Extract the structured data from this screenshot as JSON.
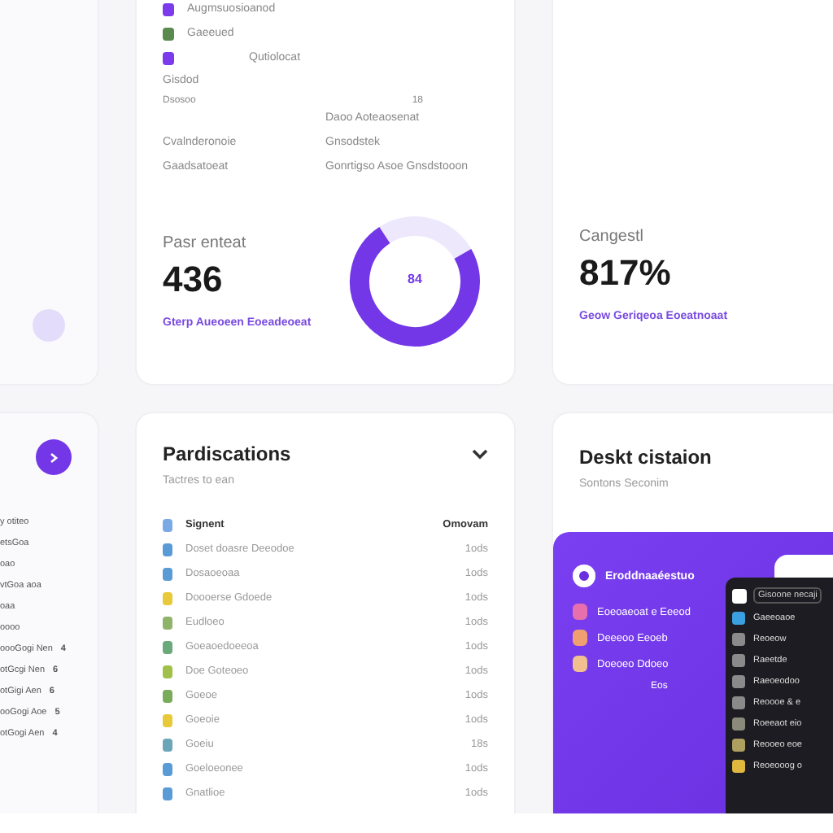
{
  "sidebar": {
    "items": [
      {
        "label": "y otiteo"
      },
      {
        "label": "etsGoa"
      },
      {
        "label": "oao"
      },
      {
        "label": "vtGoa aoa"
      },
      {
        "label": "oaa"
      },
      {
        "label": "oooo"
      },
      {
        "label": "oooGogi Nen",
        "count": "4"
      },
      {
        "label": "otGcgi Nen",
        "count": "6"
      },
      {
        "label": "otGigi Aen",
        "count": "6"
      },
      {
        "label": "ooGogi Aoe",
        "count": "5"
      },
      {
        "label": "otGogi Aen",
        "count": "4"
      }
    ]
  },
  "overview": {
    "items": [
      {
        "label": "Augmsuosioanod",
        "color": "#7c3aed"
      },
      {
        "label": "Gaeeued",
        "color": "#5b8a4e"
      },
      {
        "label": "Qutiolocat",
        "color": "#7c3aed"
      }
    ],
    "lines": [
      "Gisdod",
      "Dsosoo"
    ],
    "side_value": "18",
    "grid": [
      {
        "value": "Daoo Aoteaosenat"
      },
      {
        "label": "Cvalnderonoie",
        "value": "Gnsodstek"
      },
      {
        "label": "Gaadsatoeat",
        "value": "Gonrtigso Asoe Gnsdstooon"
      }
    ],
    "stat": {
      "label": "Pasr enteat",
      "value": "436",
      "link": "Gterp Aueoeen Eoeadeoeat"
    },
    "donut": {
      "center": "84",
      "level": 0.74
    }
  },
  "rate": {
    "label": "Cangestl",
    "value": "817%",
    "link": "Geow Geriqeoa Eoeatnoaat"
  },
  "publications": {
    "title": "Pardiscations",
    "subtitle": "Tactres to ean",
    "header": {
      "label": "Signent",
      "value": "Omovam"
    },
    "rows": [
      {
        "label": "Doset doasre Deeodoe",
        "value": "1ods",
        "color": "#5b9bd5"
      },
      {
        "label": "Dosaoeoaa",
        "value": "1ods",
        "color": "#5b9bd5"
      },
      {
        "label": "Doooerse Gdoede",
        "value": "1ods",
        "color": "#e8c93a"
      },
      {
        "label": "Eudloeo",
        "value": "1ods",
        "color": "#8fb36a"
      },
      {
        "label": "Goeaoedoeeoa",
        "value": "1ods",
        "color": "#6ba87a"
      },
      {
        "label": "Doe Goteoeo",
        "value": "1ods",
        "color": "#a0c04a"
      },
      {
        "label": "Goeoe",
        "value": "1ods",
        "color": "#7aab5a"
      },
      {
        "label": "Goeoie",
        "value": "1ods",
        "color": "#e8c93a"
      },
      {
        "label": "Goeiu",
        "value": "18s",
        "color": "#6aa6b8"
      },
      {
        "label": "Goeloeonee",
        "value": "1ods",
        "color": "#5b9bd5"
      },
      {
        "label": "Gnatlioe",
        "value": "1ods",
        "color": "#5b9bd5"
      }
    ]
  },
  "destination": {
    "title": "Deskt cistaion",
    "subtitle": "Sontons Seconim",
    "panel": {
      "heading": "Eroddnaaéestuo",
      "items": [
        {
          "label": "Eoeoaeoat e Eeeod",
          "color": "#e86fae"
        },
        {
          "label": "Deeeoo Eeoeb",
          "color": "#f0a070"
        },
        {
          "label": "Doeoeo Ddoeo",
          "color": "#f2c090"
        }
      ],
      "footer": "Eos"
    },
    "window": {
      "field": "Gisoone necaji",
      "items": [
        {
          "label": "Gaeeoaoe",
          "color": "#3aa0e0"
        },
        {
          "label": "Reoeow",
          "color": "#8a8a8a"
        },
        {
          "label": "Raeetde",
          "color": "#8a8a8a"
        },
        {
          "label": "Raeoeodoo",
          "color": "#8a8a8a"
        },
        {
          "label": "Reoooe & e",
          "color": "#8a8a8a"
        },
        {
          "label": "Roeeaot eio",
          "color": "#8a8a7a"
        },
        {
          "label": "Reooeo eoe",
          "color": "#b0a060"
        },
        {
          "label": "Reoeooog o",
          "color": "#e0b840"
        }
      ]
    }
  }
}
